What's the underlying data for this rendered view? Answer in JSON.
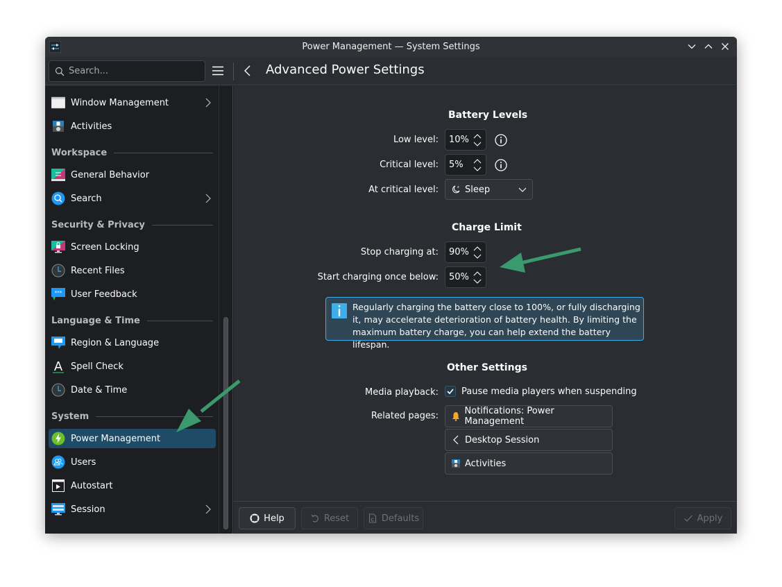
{
  "window": {
    "title": "Power Management — System Settings",
    "controls": [
      "minimize",
      "maximize",
      "close"
    ]
  },
  "toolbar": {
    "search_placeholder": "Search...",
    "page_title": "Advanced Power Settings"
  },
  "sidebar": {
    "items": [
      {
        "label": "Window Management",
        "icon": "window-management-icon",
        "has_children": true
      },
      {
        "label": "Activities",
        "icon": "activities-icon",
        "has_children": false
      }
    ],
    "sections": [
      {
        "title": "Workspace",
        "items": [
          {
            "label": "General Behavior",
            "icon": "general-behavior-icon",
            "has_children": false
          },
          {
            "label": "Search",
            "icon": "search-icon",
            "has_children": true
          }
        ]
      },
      {
        "title": "Security & Privacy",
        "items": [
          {
            "label": "Screen Locking",
            "icon": "screen-locking-icon",
            "has_children": false
          },
          {
            "label": "Recent Files",
            "icon": "clock-icon",
            "has_children": false
          },
          {
            "label": "User Feedback",
            "icon": "feedback-icon",
            "has_children": false
          }
        ]
      },
      {
        "title": "Language & Time",
        "items": [
          {
            "label": "Region & Language",
            "icon": "region-icon",
            "has_children": false
          },
          {
            "label": "Spell Check",
            "icon": "spell-check-icon",
            "has_children": false
          },
          {
            "label": "Date & Time",
            "icon": "clock-icon",
            "has_children": false
          }
        ]
      },
      {
        "title": "System",
        "items": [
          {
            "label": "Power Management",
            "icon": "power-icon",
            "has_children": false,
            "active": true
          },
          {
            "label": "Users",
            "icon": "users-icon",
            "has_children": false
          },
          {
            "label": "Autostart",
            "icon": "autostart-icon",
            "has_children": false
          },
          {
            "label": "Session",
            "icon": "session-icon",
            "has_children": true
          }
        ]
      }
    ]
  },
  "battery_levels": {
    "title": "Battery Levels",
    "low_level_label": "Low level:",
    "low_level_value": "10%",
    "critical_level_label": "Critical level:",
    "critical_level_value": "5%",
    "at_critical_label": "At critical level:",
    "at_critical_value": "Sleep"
  },
  "charge_limit": {
    "title": "Charge Limit",
    "stop_label": "Stop charging at:",
    "stop_value": "90%",
    "start_label": "Start charging once below:",
    "start_value": "50%",
    "info_message": "Regularly charging the battery close to 100%, or fully discharging it, may accelerate deterioration of battery health. By limiting the maximum battery charge, you can help extend the battery lifespan."
  },
  "other_settings": {
    "title": "Other Settings",
    "media_label": "Media playback:",
    "media_checkbox_label": "Pause media players when suspending",
    "media_checked": true,
    "related_label": "Related pages:",
    "related_pages": [
      {
        "label": "Notifications: Power Management",
        "icon": "bell-icon"
      },
      {
        "label": "Desktop Session",
        "icon": "chevron-left-icon"
      },
      {
        "label": "Activities",
        "icon": "activities-icon"
      }
    ]
  },
  "footer": {
    "help": "Help",
    "reset": "Reset",
    "defaults": "Defaults",
    "apply": "Apply"
  },
  "colors": {
    "accent": "#3daee9",
    "selection": "#1f4b66",
    "annotation_arrow": "#3a9a6e"
  }
}
